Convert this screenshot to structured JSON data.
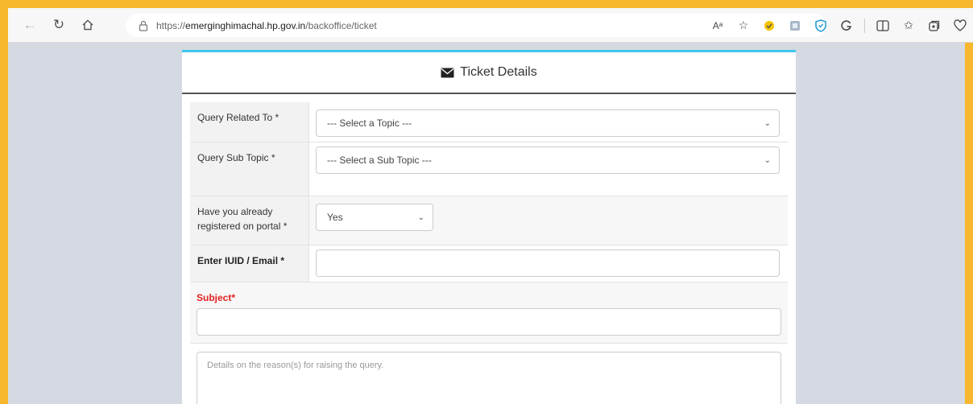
{
  "browser": {
    "url_prefix": "https://",
    "url_domain": "emerginghimachal.hp.gov.in",
    "url_path": "/backoffice/ticket",
    "read_aloud_icon": "Aᵃ"
  },
  "card": {
    "title": "Ticket Details"
  },
  "form": {
    "query_related_label": "Query Related To *",
    "query_related_value": "--- Select a Topic ---",
    "sub_topic_label": "Query Sub Topic *",
    "sub_topic_value": "--- Select a Sub Topic ---",
    "registered_label": "Have you already registered on portal *",
    "registered_value": "Yes",
    "iuid_label": "Enter IUID / Email *",
    "iuid_value": "",
    "subject_label": "Subject*",
    "subject_value": "",
    "details_placeholder": "Details on the reason(s) for raising the query."
  },
  "colors": {
    "frame": "#f7b82e",
    "accent": "#3ec7ea",
    "required_red": "#e32222"
  }
}
